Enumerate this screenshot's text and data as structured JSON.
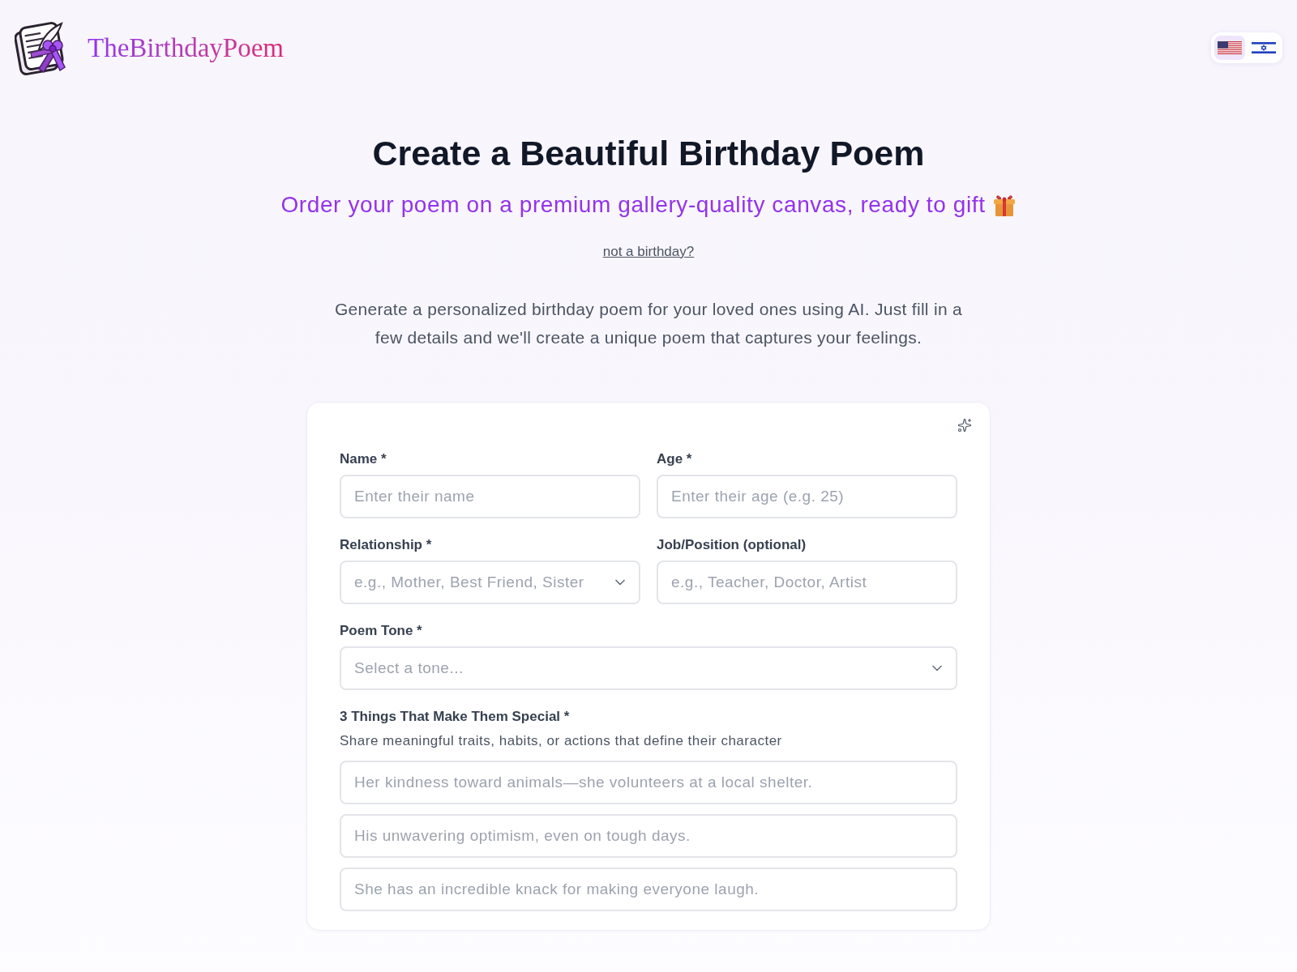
{
  "header": {
    "brand": "TheBirthdayPoem",
    "languages": [
      {
        "kind": "us",
        "selected": true
      },
      {
        "kind": "israel",
        "selected": false
      }
    ]
  },
  "hero": {
    "title": "Create a Beautiful Birthday Poem",
    "subtitle": "Order your poem on a premium gallery-quality canvas, ready to gift",
    "link": "not a birthday?",
    "description": "Generate a personalized birthday poem for your loved ones using AI. Just fill in a few details and we'll create a unique poem that captures your feelings."
  },
  "form": {
    "rows": [
      {
        "fields": [
          {
            "kind": "text",
            "label": "Name *",
            "placeholder": "Enter their name"
          },
          {
            "kind": "text",
            "label": "Age *",
            "placeholder": "Enter their age (e.g. 25)"
          }
        ]
      },
      {
        "fields": [
          {
            "kind": "select",
            "label": "Relationship *",
            "placeholder": "e.g., Mother, Best Friend, Sister"
          },
          {
            "kind": "text",
            "label": "Job/Position (optional)",
            "placeholder": "e.g., Teacher, Doctor, Artist"
          }
        ]
      },
      {
        "fields": [
          {
            "kind": "select",
            "label": "Poem Tone *",
            "placeholder": "Select a tone..."
          }
        ]
      }
    ],
    "special": {
      "label": "3 Things That Make Them Special *",
      "hint": "Share meaningful traits, habits, or actions that define their character",
      "inputs": [
        {
          "placeholder": "Her kindness toward animals—she volunteers at a local shelter."
        },
        {
          "placeholder": "His unwavering optimism, even on tough days."
        },
        {
          "placeholder": "She has an incredible knack for making everyone laugh."
        }
      ]
    }
  }
}
